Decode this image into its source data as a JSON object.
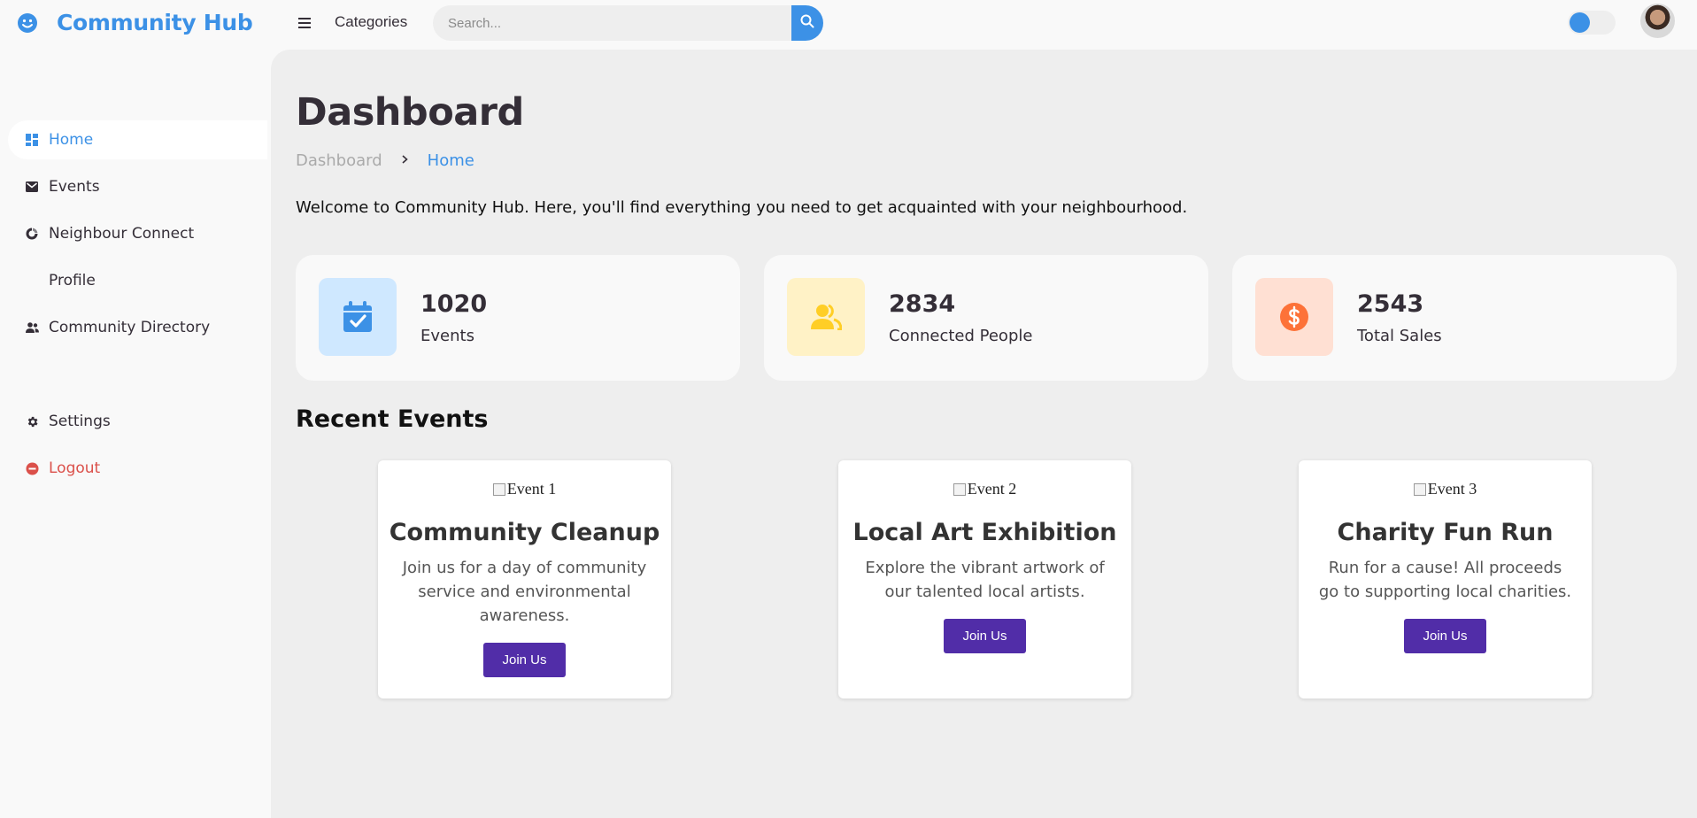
{
  "app": {
    "name": "Community Hub",
    "accent": "#3c91e6"
  },
  "header": {
    "categories_label": "Categories",
    "search_placeholder": "Search...",
    "search_value": ""
  },
  "sidebar": {
    "items": [
      {
        "label": "Home",
        "icon": "dashboard-icon",
        "active": true
      },
      {
        "label": "Events",
        "icon": "mail-icon"
      },
      {
        "label": "Neighbour Connect",
        "icon": "donut-chart-icon"
      },
      {
        "label": "Profile",
        "icon": ""
      },
      {
        "label": "Community Directory",
        "icon": "people-icon"
      }
    ],
    "bottom": [
      {
        "label": "Settings",
        "icon": "gear-icon"
      },
      {
        "label": "Logout",
        "icon": "logout-icon",
        "color": "#db504a"
      }
    ]
  },
  "main": {
    "title": "Dashboard",
    "breadcrumb": {
      "root": "Dashboard",
      "current": "Home"
    },
    "welcome": "Welcome to Community Hub. Here, you'll find everything you need to get acquainted with your neighbourhood.",
    "stats": [
      {
        "value": "1020",
        "label": "Events",
        "icon": "calendar-check-icon",
        "bg": "#cfe8ff",
        "fg": "#3c91e6"
      },
      {
        "value": "2834",
        "label": "Connected People",
        "icon": "group-icon",
        "bg": "#fff2c6",
        "fg": "#ffce26"
      },
      {
        "value": "2543",
        "label": "Total Sales",
        "icon": "dollar-circle-icon",
        "bg": "#ffe0d3",
        "fg": "#fd7238"
      }
    ],
    "recent_title": "Recent Events",
    "events": [
      {
        "img_alt": "Event 1",
        "title": "Community Cleanup",
        "desc": "Join us for a day of community service and environmental awareness.",
        "button": "Join Us"
      },
      {
        "img_alt": "Event 2",
        "title": "Local Art Exhibition",
        "desc": "Explore the vibrant artwork of our talented local artists.",
        "button": "Join Us"
      },
      {
        "img_alt": "Event 3",
        "title": "Charity Fun Run",
        "desc": "Run for a cause! All proceeds go to supporting local charities.",
        "button": "Join Us"
      }
    ]
  }
}
